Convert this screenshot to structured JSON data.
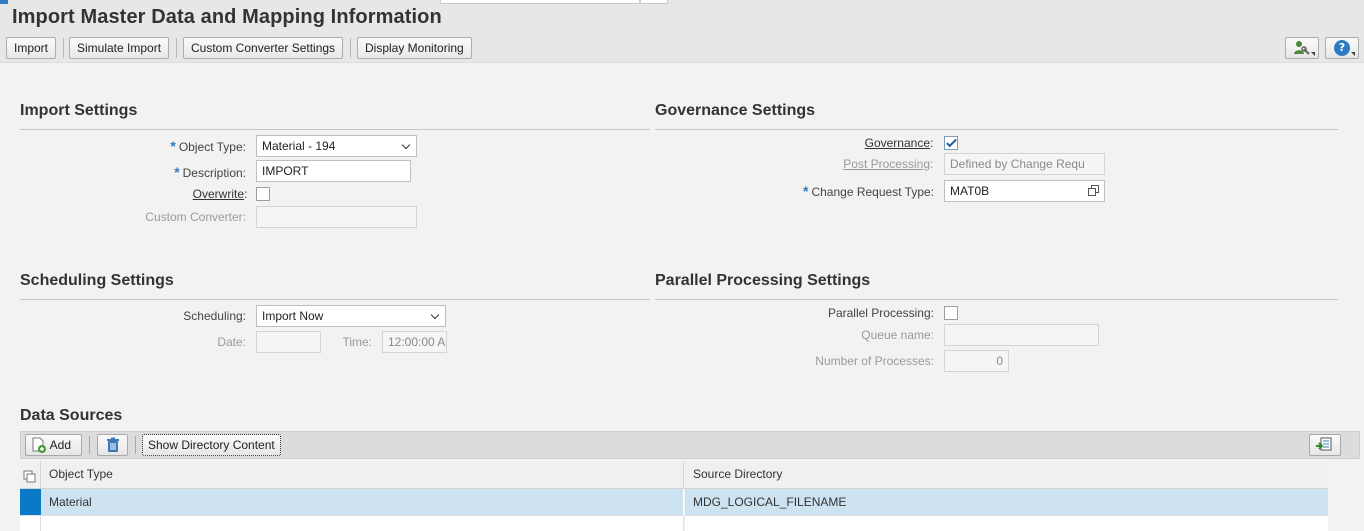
{
  "page": {
    "title": "Import Master Data and Mapping Information"
  },
  "toolbar": {
    "import_label": "Import",
    "simulate_label": "Simulate Import",
    "converter_label": "Custom Converter Settings",
    "monitoring_label": "Display Monitoring",
    "help_glyph": "?"
  },
  "import_settings": {
    "title": "Import Settings",
    "object_type_label": "Object Type:",
    "object_type_value": "Material - 194",
    "description_label": "Description:",
    "description_value": "IMPORT",
    "overwrite_label": "Overwrite",
    "overwrite_checked": false,
    "custom_converter_label": "Custom Converter:",
    "custom_converter_value": ""
  },
  "governance_settings": {
    "title": "Governance Settings",
    "governance_label": "Governance",
    "governance_checked": true,
    "post_processing_label": "Post Processing",
    "post_processing_value": "Defined by Change Requ",
    "cr_type_label": "Change Request Type:",
    "cr_type_value": "MAT0B"
  },
  "scheduling_settings": {
    "title": "Scheduling Settings",
    "scheduling_label": "Scheduling:",
    "scheduling_value": "Import Now",
    "date_label": "Date:",
    "date_value": "",
    "time_label": "Time:",
    "time_value": "12:00:00 A"
  },
  "parallel_settings": {
    "title": "Parallel Processing Settings",
    "parallel_label": "Parallel Processing:",
    "parallel_checked": false,
    "queue_label": "Queue name:",
    "queue_value": "",
    "processes_label": "Number of Processes:",
    "processes_value": "0"
  },
  "data_sources": {
    "title": "Data Sources",
    "add_label": "Add",
    "show_dir_label": "Show Directory Content",
    "columns": [
      "Object Type",
      "Source Directory"
    ],
    "rows": [
      [
        "Material",
        "MDG_LOGICAL_FILENAME"
      ],
      [
        "",
        ""
      ]
    ]
  },
  "colors": {
    "accent": "#2d7cc1",
    "selected_row": "#cde3f1",
    "row_marker": "#0a79c6"
  },
  "icons": [
    "user-settings-icon",
    "help-icon",
    "add-document-icon",
    "trash-icon",
    "export-icon",
    "select-all-icon",
    "value-help-icon",
    "dropdown-arrow-icon",
    "checkmark-icon"
  ]
}
